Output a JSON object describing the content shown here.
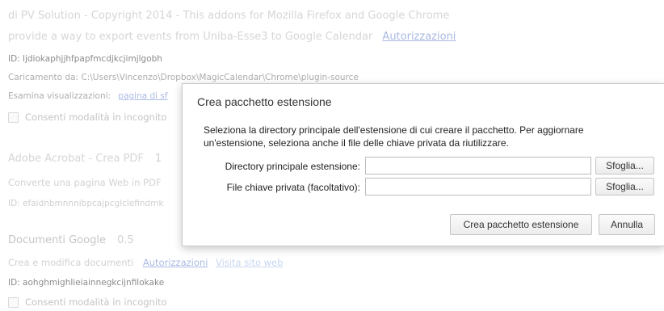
{
  "background": {
    "ext1": {
      "description_line1": "di PV Solution - Copyright 2014 - This addons for Mozilla Firefox and Google Chrome",
      "description_line2": "provide a way to export events from Uniba-Esse3 to Google Calendar",
      "permissions_link": "Autorizzazioni",
      "id_line": "ID: ljdiokaphjjhfpapfmcdjkcjimjlgobh",
      "loaded_from": "Caricamento da: C:\\Users\\Vincenzo\\Dropbox\\MagicCalendar\\Chrome\\plugin-source",
      "inspect_label": "Esamina visualizzazioni:",
      "inspect_link": "pagina di sf",
      "incognito_label": "Consenti modalità in incognito"
    },
    "ext2": {
      "name": "Adobe Acrobat - Crea PDF",
      "version": "1",
      "description": "Converte una pagina Web in PDF",
      "id_line": "ID: efaidnbmnnnibpcajpcglclefindmk"
    },
    "ext3": {
      "name": "Documenti Google",
      "version": "0.5",
      "description": "Crea e modifica documenti",
      "permissions_link": "Autorizzazioni",
      "website_link": "Visita sito web",
      "id_line": "ID: aohghmighlieiainnegkcijnfilokake",
      "incognito_label": "Consenti modalità in incognito"
    }
  },
  "dialog": {
    "title": "Crea pacchetto estensione",
    "description": "Seleziona la directory principale dell'estensione di cui creare il pacchetto. Per aggiornare un'estensione, seleziona anche il file delle chiave privata da riutilizzare.",
    "root_dir_label": "Directory principale estensione:",
    "root_dir_value": "",
    "private_key_label": "File chiave privata (facoltativo):",
    "private_key_value": "",
    "browse_label": "Sfoglia...",
    "create_button": "Crea pacchetto estensione",
    "cancel_button": "Annulla"
  }
}
